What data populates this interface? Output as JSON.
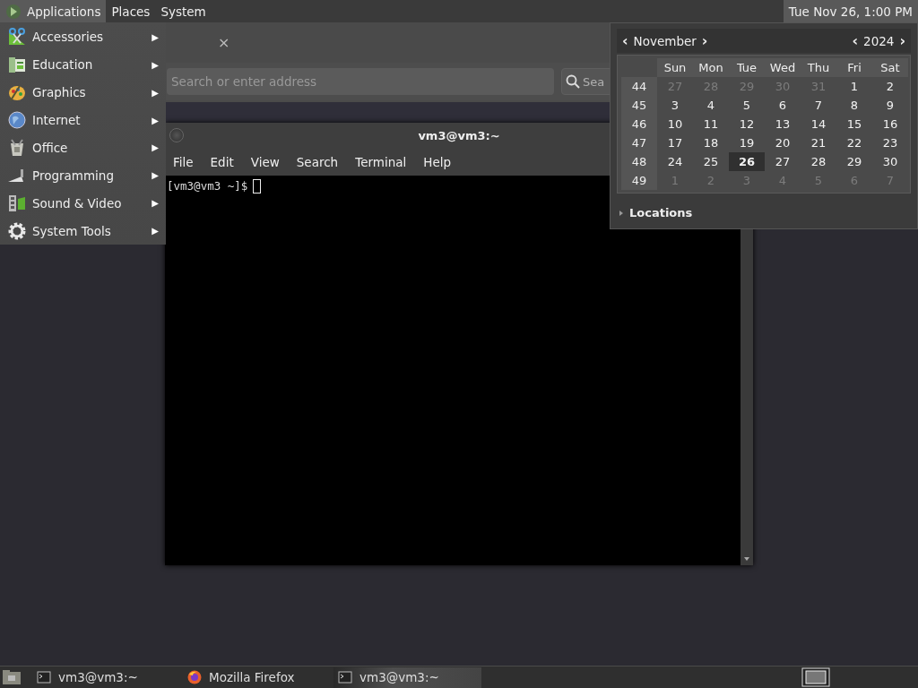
{
  "top_panel": {
    "menus": [
      {
        "label": "Applications",
        "selected": true
      },
      {
        "label": "Places",
        "selected": false
      },
      {
        "label": "System",
        "selected": false
      }
    ],
    "clock": {
      "label": "Tue Nov 26, 1:00 PM",
      "selected": true
    }
  },
  "applications_menu": {
    "items": [
      {
        "label": "Accessories",
        "arrow": "▶"
      },
      {
        "label": "Education",
        "arrow": "▶"
      },
      {
        "label": "Graphics",
        "arrow": "▶"
      },
      {
        "label": "Internet",
        "arrow": "▶"
      },
      {
        "label": "Office",
        "arrow": "▶"
      },
      {
        "label": "Programming",
        "arrow": "▶"
      },
      {
        "label": "Sound & Video",
        "arrow": "▶"
      },
      {
        "label": "System Tools",
        "arrow": "▶"
      }
    ]
  },
  "firefox_window": {
    "tab_close": "×",
    "address_field": {
      "placeholder": "Search or enter address"
    },
    "search_field": {
      "placeholder": "Sea"
    }
  },
  "terminal_window": {
    "title": "vm3@vm3:~",
    "menus": [
      "File",
      "Edit",
      "View",
      "Search",
      "Terminal",
      "Help"
    ],
    "prompt": "[vm3@vm3 ~]$"
  },
  "calendar": {
    "prev_month": "‹",
    "month": "November",
    "next_month": "›",
    "prev_year": "‹",
    "year": "2024",
    "next_year": "›",
    "weekdays": [
      "Sun",
      "Mon",
      "Tue",
      "Wed",
      "Thu",
      "Fri",
      "Sat"
    ],
    "weeks": [
      {
        "number": "44",
        "days": [
          {
            "label": "27",
            "outside_month": true,
            "selected": false
          },
          {
            "label": "28",
            "outside_month": true,
            "selected": false
          },
          {
            "label": "29",
            "outside_month": true,
            "selected": false
          },
          {
            "label": "30",
            "outside_month": true,
            "selected": false
          },
          {
            "label": "31",
            "outside_month": true,
            "selected": false
          },
          {
            "label": "1",
            "outside_month": false,
            "selected": false
          },
          {
            "label": "2",
            "outside_month": false,
            "selected": false
          }
        ]
      },
      {
        "number": "45",
        "days": [
          {
            "label": "3",
            "outside_month": false,
            "selected": false
          },
          {
            "label": "4",
            "outside_month": false,
            "selected": false
          },
          {
            "label": "5",
            "outside_month": false,
            "selected": false
          },
          {
            "label": "6",
            "outside_month": false,
            "selected": false
          },
          {
            "label": "7",
            "outside_month": false,
            "selected": false
          },
          {
            "label": "8",
            "outside_month": false,
            "selected": false
          },
          {
            "label": "9",
            "outside_month": false,
            "selected": false
          }
        ]
      },
      {
        "number": "46",
        "days": [
          {
            "label": "10",
            "outside_month": false,
            "selected": false
          },
          {
            "label": "11",
            "outside_month": false,
            "selected": false
          },
          {
            "label": "12",
            "outside_month": false,
            "selected": false
          },
          {
            "label": "13",
            "outside_month": false,
            "selected": false
          },
          {
            "label": "14",
            "outside_month": false,
            "selected": false
          },
          {
            "label": "15",
            "outside_month": false,
            "selected": false
          },
          {
            "label": "16",
            "outside_month": false,
            "selected": false
          }
        ]
      },
      {
        "number": "47",
        "days": [
          {
            "label": "17",
            "outside_month": false,
            "selected": false
          },
          {
            "label": "18",
            "outside_month": false,
            "selected": false
          },
          {
            "label": "19",
            "outside_month": false,
            "selected": false
          },
          {
            "label": "20",
            "outside_month": false,
            "selected": false
          },
          {
            "label": "21",
            "outside_month": false,
            "selected": false
          },
          {
            "label": "22",
            "outside_month": false,
            "selected": false
          },
          {
            "label": "23",
            "outside_month": false,
            "selected": false
          }
        ]
      },
      {
        "number": "48",
        "days": [
          {
            "label": "24",
            "outside_month": false,
            "selected": false
          },
          {
            "label": "25",
            "outside_month": false,
            "selected": false
          },
          {
            "label": "26",
            "outside_month": false,
            "selected": true
          },
          {
            "label": "27",
            "outside_month": false,
            "selected": false
          },
          {
            "label": "28",
            "outside_month": false,
            "selected": false
          },
          {
            "label": "29",
            "outside_month": false,
            "selected": false
          },
          {
            "label": "30",
            "outside_month": false,
            "selected": false
          }
        ]
      },
      {
        "number": "49",
        "days": [
          {
            "label": "1",
            "outside_month": true,
            "selected": false
          },
          {
            "label": "2",
            "outside_month": true,
            "selected": false
          },
          {
            "label": "3",
            "outside_month": true,
            "selected": false
          },
          {
            "label": "4",
            "outside_month": true,
            "selected": false
          },
          {
            "label": "5",
            "outside_month": true,
            "selected": false
          },
          {
            "label": "6",
            "outside_month": true,
            "selected": false
          },
          {
            "label": "7",
            "outside_month": true,
            "selected": false
          }
        ]
      }
    ],
    "locations": {
      "label": "Locations",
      "expanded": false
    }
  },
  "taskbar": {
    "tasks": [
      {
        "label": "vm3@vm3:~",
        "kind": "terminal",
        "selected": false
      },
      {
        "label": "Mozilla Firefox",
        "kind": "firefox",
        "selected": false
      },
      {
        "label": "vm3@vm3:~",
        "kind": "terminal",
        "selected": true
      }
    ]
  }
}
